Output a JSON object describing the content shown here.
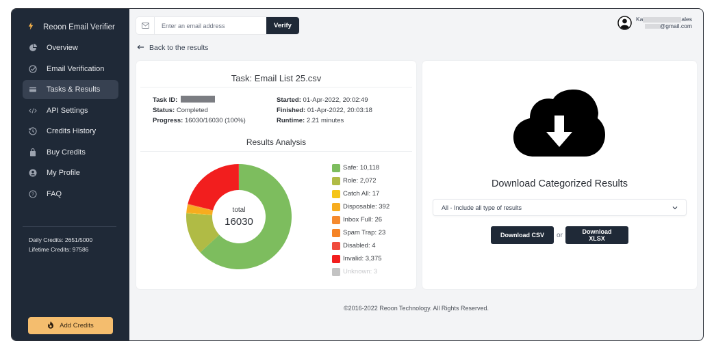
{
  "sidebar": {
    "brand": "Reoon Email Verifier",
    "items": [
      {
        "label": "Overview",
        "icon": "pie-chart-icon",
        "active": false
      },
      {
        "label": "Email Verification",
        "icon": "check-circle-icon",
        "active": false
      },
      {
        "label": "Tasks & Results",
        "icon": "credit-card-icon",
        "active": true
      },
      {
        "label": "API Settings",
        "icon": "code-icon",
        "active": false
      },
      {
        "label": "Credits History",
        "icon": "history-icon",
        "active": false
      },
      {
        "label": "Buy Credits",
        "icon": "shopping-bag-icon",
        "active": false
      },
      {
        "label": "My Profile",
        "icon": "user-circle-icon",
        "active": false
      },
      {
        "label": "FAQ",
        "icon": "question-circle-icon",
        "active": false
      }
    ],
    "daily_credits": "Daily Credits: 2651/5000",
    "lifetime_credits": "Lifetime Credits: 97586",
    "add_credits_label": "Add Credits"
  },
  "topbar": {
    "email_placeholder": "Enter an email address",
    "email_value": "",
    "verify_label": "Verify",
    "back_label": "Back to the results"
  },
  "user": {
    "name_prefix": "Ka",
    "name_suffix": "ales",
    "email_suffix": "@gmail.com"
  },
  "task": {
    "title": "Task: Email List 25.csv",
    "task_id_label": "Task ID:",
    "status_label": "Status:",
    "status_value": "Completed",
    "progress_label": "Progress:",
    "progress_value": "16030/16030 (100%)",
    "started_label": "Started:",
    "started_value": "01-Apr-2022, 20:02:49",
    "finished_label": "Finished:",
    "finished_value": "01-Apr-2022, 20:03:18",
    "runtime_label": "Runtime:",
    "runtime_value": "2.21 minutes",
    "analysis_title": "Results Analysis"
  },
  "chart_data": {
    "type": "pie",
    "donut": true,
    "title": "Results Analysis",
    "center_label": "total",
    "center_value": "16030",
    "legend_position": "right",
    "slices": [
      {
        "label": "Safe",
        "value": 10118,
        "display": "Safe: 10,118",
        "color": "#7dbd5e",
        "muted": false
      },
      {
        "label": "Role",
        "value": 2072,
        "display": "Role: 2,072",
        "color": "#b0bb45",
        "muted": false
      },
      {
        "label": "Catch All",
        "value": 17,
        "display": "Catch All: 17",
        "color": "#f5c518",
        "muted": false
      },
      {
        "label": "Disposable",
        "value": 392,
        "display": "Disposable: 392",
        "color": "#f7ac1e",
        "muted": false
      },
      {
        "label": "Inbox Full",
        "value": 26,
        "display": "Inbox Full: 26",
        "color": "#f58a2e",
        "muted": false
      },
      {
        "label": "Spam Trap",
        "value": 23,
        "display": "Spam Trap: 23",
        "color": "#f58325",
        "muted": false
      },
      {
        "label": "Disabled",
        "value": 4,
        "display": "Disabled: 4",
        "color": "#f04b3c",
        "muted": false
      },
      {
        "label": "Invalid",
        "value": 3375,
        "display": "Invalid: 3,375",
        "color": "#f21e1e",
        "muted": false
      },
      {
        "label": "Unknown",
        "value": 3,
        "display": "Unknown: 3",
        "color": "#c3c3c3",
        "muted": true
      }
    ]
  },
  "download": {
    "title": "Download Categorized Results",
    "select_value": "All - Include all type of results",
    "csv_label": "Download CSV",
    "or_label": "or",
    "xlsx_label": "Download XLSX"
  },
  "footer": {
    "text": "©2016-2022 Reoon Technology. All Rights Reserved."
  }
}
